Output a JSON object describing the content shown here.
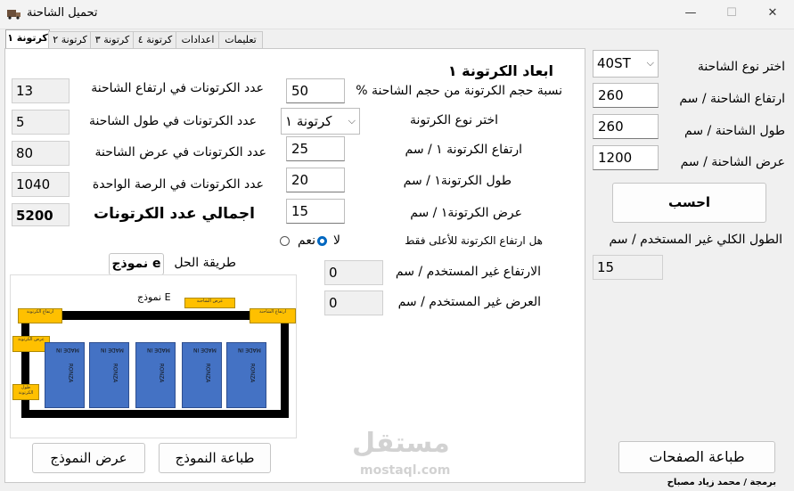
{
  "window": {
    "title": "تحميل الشاحنة",
    "icon": "truck-app-icon",
    "minimize": "—",
    "maximize": "☐",
    "close": "✕"
  },
  "tabs": [
    {
      "label": "كرتونة ١"
    },
    {
      "label": "كرتونة ٢"
    },
    {
      "label": "كرتونة ٣"
    },
    {
      "label": "كرتونة ٤"
    },
    {
      "label": "اعدادات"
    },
    {
      "label": "تعليمات"
    }
  ],
  "carton": {
    "heading": "ابعاد الكرتونة ١",
    "volume_pct_label": "نسبة حجم الكرتونة من حجم الشاحنة %",
    "volume_pct": "50",
    "type_label": "اختر نوع الكرتونة",
    "type_value": "كرتونة ١",
    "height_label": "ارتفاع الكرتونة ١ / سم",
    "height": "25",
    "length_label": "طول الكرتونة١ / سم",
    "length": "20",
    "width_label": "عرض الكرتونة١ / سم",
    "width": "15",
    "top_only_label": "هل ارتفاع الكرتونة للأعلى فقط",
    "yes_label": "نعم",
    "no_label": "لا",
    "unused_height_label": "الارتفاع غير المستخدم / سم",
    "unused_height": "0",
    "unused_width_label": "العرض غير المستخدم / سم",
    "unused_width": "0"
  },
  "counts": {
    "height_count_label": "عدد الكرتونات في ارتفاع الشاحنة",
    "height_count": "13",
    "length_count_label": "عدد الكرتونات في طول الشاحنة",
    "length_count": "5",
    "width_count_label": "عدد الكرتونات في عرض الشاحنة",
    "width_count": "80",
    "pallet_count_label": "عدد الكرتونات في الرصة الواحدة",
    "pallet_count": "1040",
    "total_label": "اجمالي عدد الكرتونات",
    "total": "5200"
  },
  "solution": {
    "method_label": "طريقة الحل",
    "method_value": "نموذج e",
    "diagram_title": "نموذج E",
    "diagram_labels": {
      "truck_width": "عرض الشاحنة",
      "carton_height": "ارتفاع الكرتونة",
      "truck_height": "ارتفاع الشاحنة",
      "carton_width": "عرض الكرتونة",
      "carton_length": "طول الكرتونة"
    },
    "box_text_top": "MADE IN",
    "box_text_side": "RONZA",
    "print_button": "طباعة النموذج",
    "show_button": "عرض النموذج"
  },
  "truck": {
    "type_label": "اختر نوع الشاحنة",
    "type_value": "40ST",
    "height_label": "ارتفاع الشاحنة / سم",
    "height": "260",
    "length_label": "طول الشاحنة / سم",
    "length": "260",
    "width_label": "عرض الشاحنة / سم",
    "width": "1200",
    "calc_button": "احسب",
    "unused_total_label": "الطول الكلي غير المستخدم / سم",
    "unused_total": "15",
    "print_pages_button": "طباعة الصفحات"
  },
  "watermark": {
    "brand": "مستقل",
    "domain": "mostaql.com"
  },
  "credits": "برمجة / محمد زياد مصباح"
}
